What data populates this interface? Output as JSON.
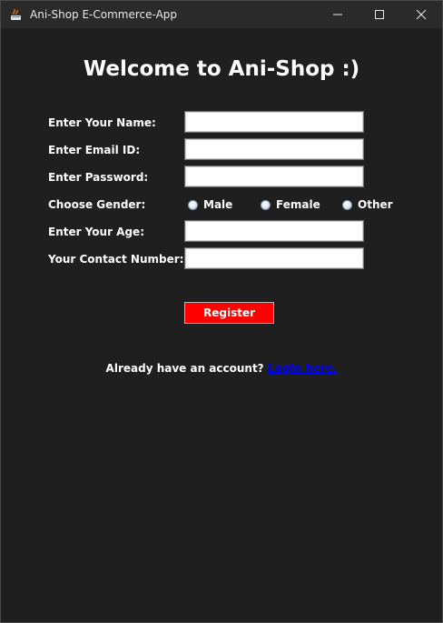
{
  "window": {
    "title": "Ani-Shop E-Commerce-App"
  },
  "heading": "Welcome to Ani-Shop :)",
  "form": {
    "name_label": "Enter Your Name:",
    "email_label": "Enter Email ID:",
    "password_label": "Enter Password:",
    "gender_label": "Choose Gender:",
    "gender_options": [
      "Male",
      "Female",
      "Other"
    ],
    "age_label": "Enter Your Age:",
    "contact_label": "Your Contact Number:",
    "name_value": "",
    "email_value": "",
    "password_value": "",
    "age_value": "",
    "contact_value": ""
  },
  "register_label": "Register",
  "footer": {
    "prompt": "Already have an account?",
    "link": "Login here."
  },
  "colors": {
    "background": "#1f1f1f",
    "register_button": "#ff0000",
    "link": "#0000ff"
  }
}
